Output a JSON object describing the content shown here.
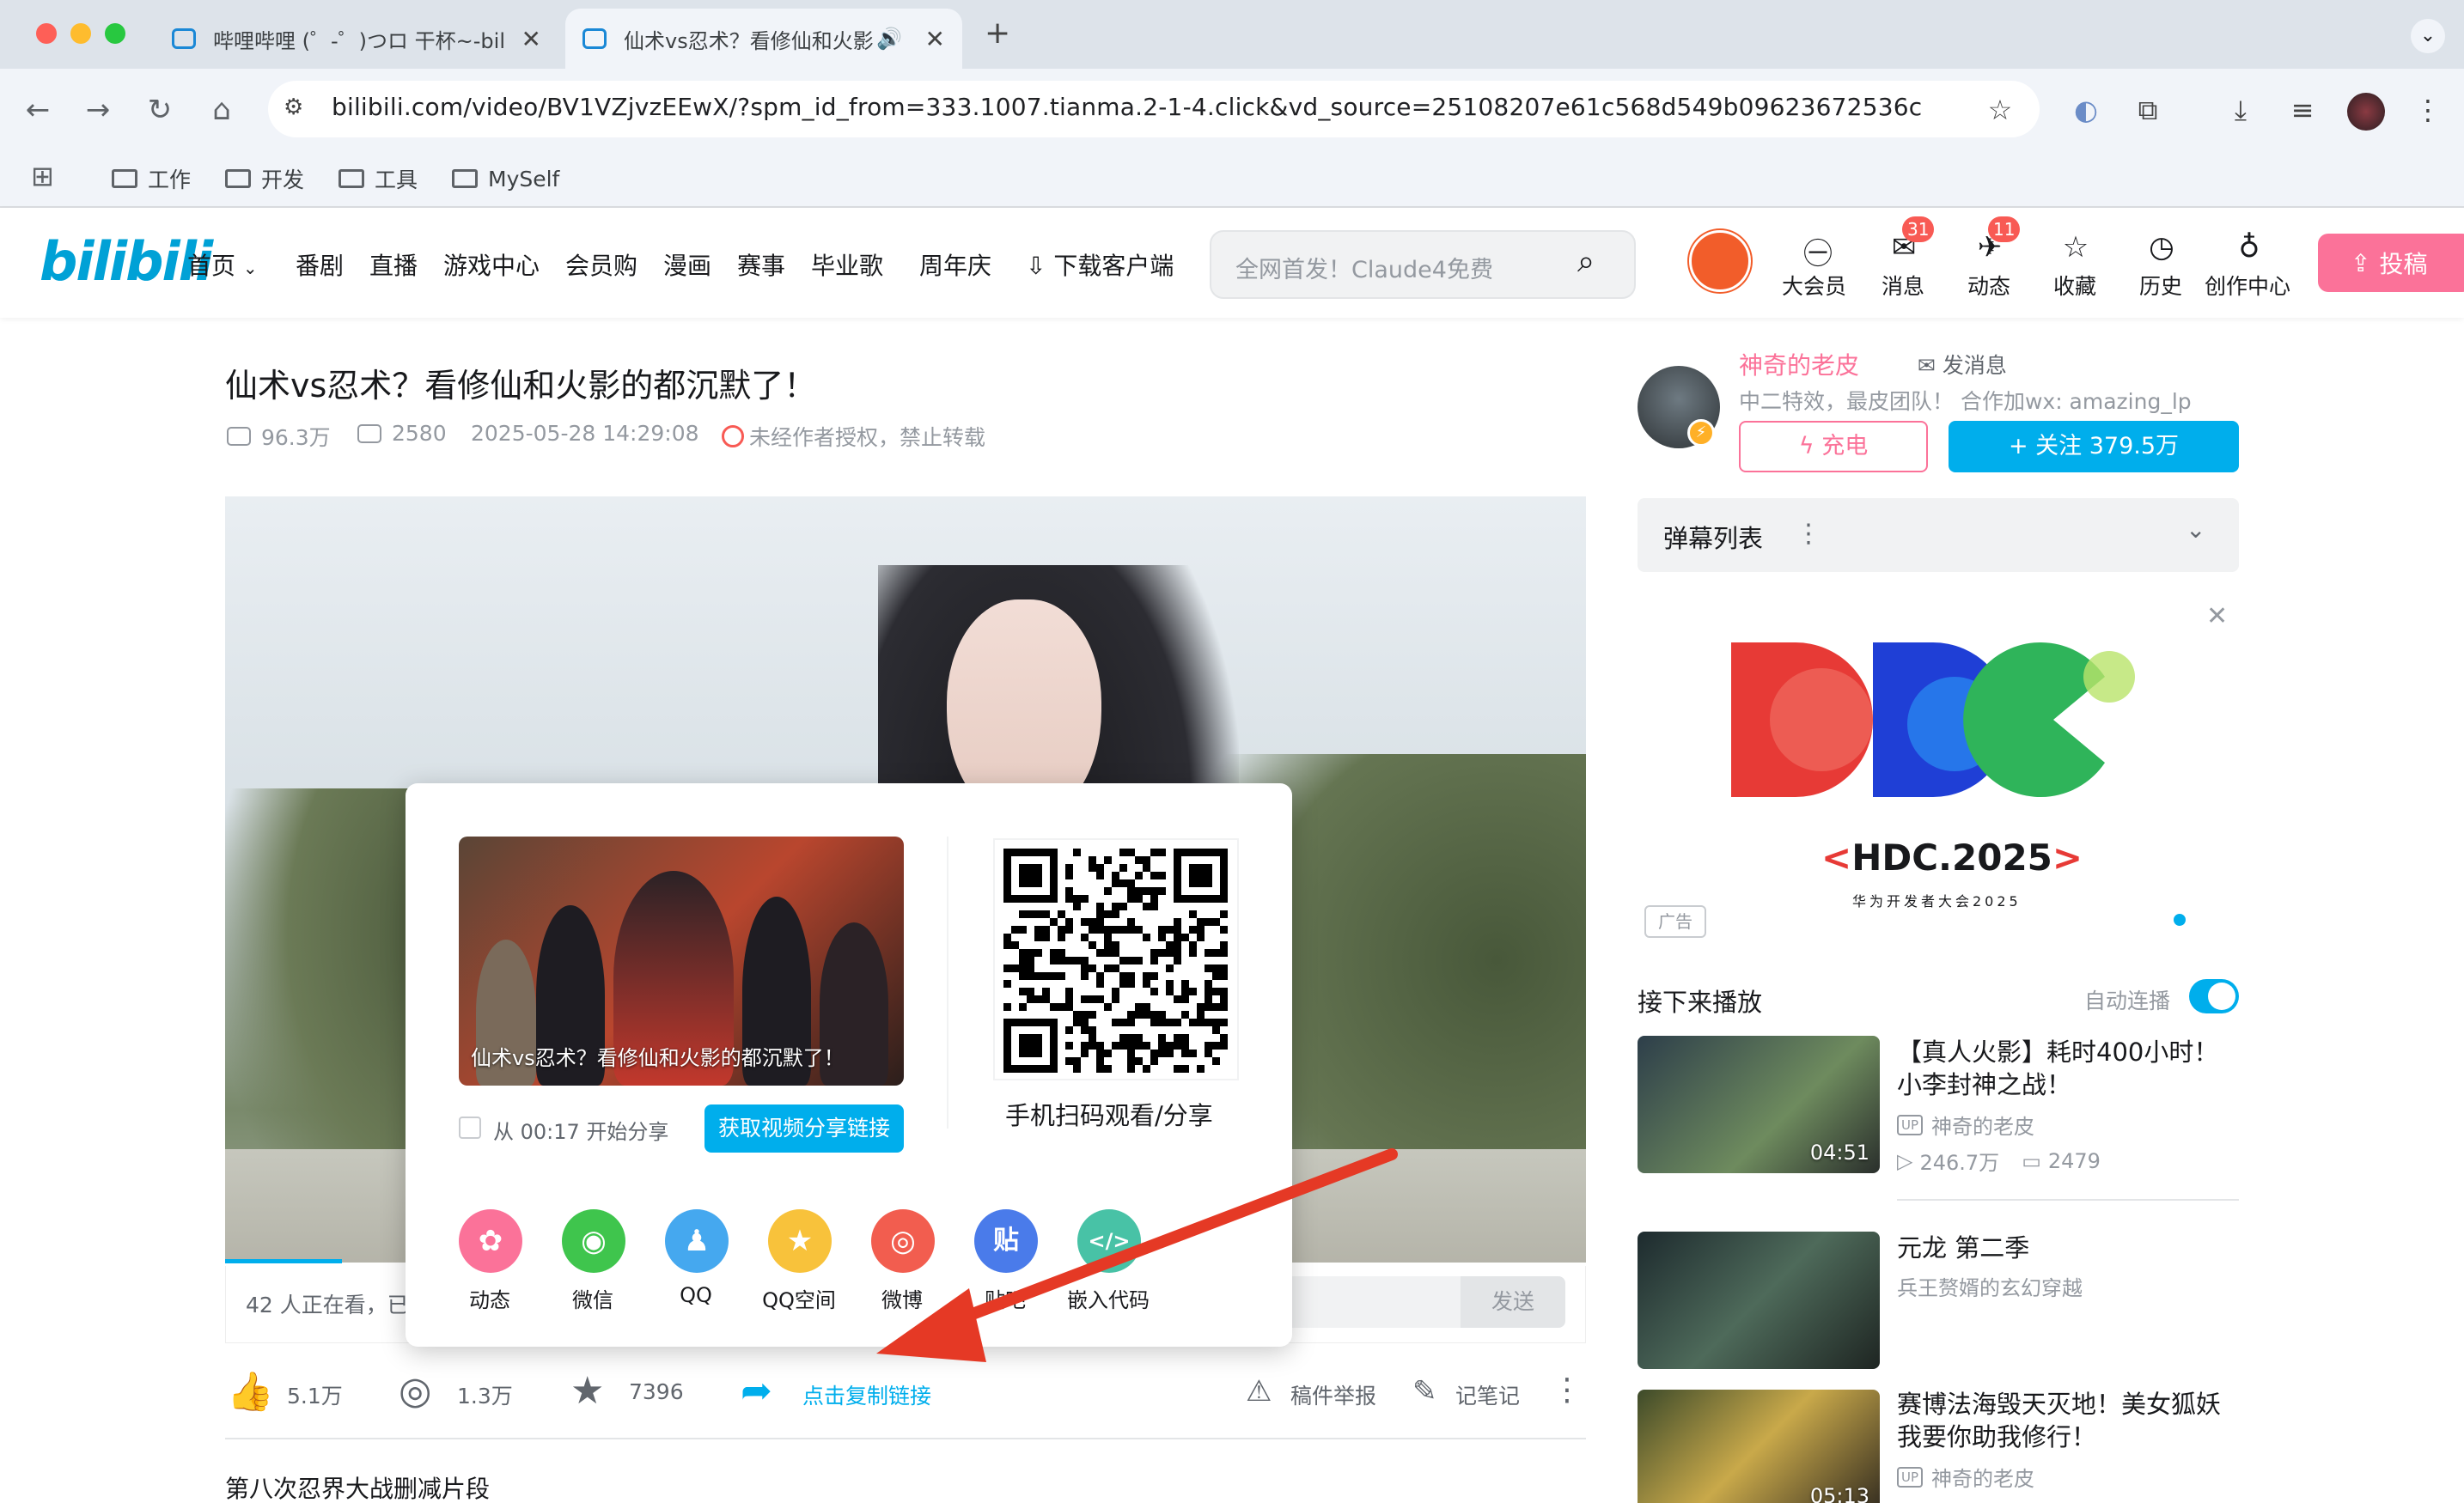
{
  "browser": {
    "tabs": [
      {
        "title": "哔哩哔哩 (゜-゜)つロ 干杯~-bili",
        "active": false
      },
      {
        "title": "仙术vs忍术？看修仙和火影",
        "active": true
      }
    ],
    "new_tab": "+",
    "url": "bilibili.com/video/BV1VZjvzEEwX/?spm_id_from=333.1007.tianma.2-1-4.click&vd_source=25108207e61c568d549b09623672536c",
    "bookmarks": [
      "工作",
      "开发",
      "工具",
      "MySelf"
    ]
  },
  "header": {
    "logo": "bilibili",
    "nav": [
      "首页",
      "番剧",
      "直播",
      "游戏中心",
      "会员购",
      "漫画",
      "赛事",
      "毕业歌",
      "周年庆",
      "下载客户端"
    ],
    "search_placeholder": "全网首发！Claude4免费",
    "icons": [
      {
        "label": "大会员",
        "icon": "vip-icon"
      },
      {
        "label": "消息",
        "icon": "message-icon",
        "badge": "31"
      },
      {
        "label": "动态",
        "icon": "dynamic-icon",
        "badge": "11"
      },
      {
        "label": "收藏",
        "icon": "favorite-icon"
      },
      {
        "label": "历史",
        "icon": "history-icon"
      },
      {
        "label": "创作中心",
        "icon": "creator-icon"
      }
    ],
    "upload": "投稿"
  },
  "video": {
    "title": "仙术vs忍术？看修仙和火影的都沉默了！",
    "views": "96.3万",
    "danmaku": "2580",
    "date": "2025-05-28 14:29:08",
    "no_repost": "未经作者授权，禁止转载",
    "progress": 0.086
  },
  "danmaku_bar": {
    "viewers": "42 人正在看，已",
    "send": "发送"
  },
  "share": {
    "thumb_caption": "仙术vs忍术？看修仙和火影的都沉默了！",
    "start_label": "从 00:17 开始分享",
    "get_link": "获取视频分享链接",
    "qr_label": "手机扫码观看/分享",
    "targets": [
      {
        "label": "动态",
        "color": "#fb7299",
        "glyph": "✿"
      },
      {
        "label": "微信",
        "color": "#3fc54d",
        "glyph": "◉"
      },
      {
        "label": "QQ",
        "color": "#45a8ef",
        "glyph": "♟"
      },
      {
        "label": "QQ空间",
        "color": "#f8c23b",
        "glyph": "★"
      },
      {
        "label": "微博",
        "color": "#f25d4f",
        "glyph": "◎"
      },
      {
        "label": "贴吧",
        "color": "#4a7bea",
        "glyph": "贴"
      },
      {
        "label": "嵌入代码",
        "color": "#48c2a6",
        "glyph": "</>"
      }
    ]
  },
  "actions": {
    "like": "5.1万",
    "coin": "1.3万",
    "fav": "7396",
    "copy_link": "点击复制链接",
    "report": "稿件举报",
    "note": "记笔记"
  },
  "section_title": "第八次忍界大战删减片段",
  "uploader": {
    "name": "神奇的老皮",
    "message": "发消息",
    "desc": "中二特效，最皮团队！ 合作加wx: amazing_lp",
    "charge": "充电",
    "follow": "+ 关注 379.5万"
  },
  "danmaku_list": {
    "label": "弹幕列表"
  },
  "ad": {
    "title_main": "HDC.2025",
    "subtitle": "华为开发者大会2025",
    "tag": "广告"
  },
  "upnext": {
    "label": "接下来播放",
    "autoplay": "自动连播",
    "items": [
      {
        "title": "【真人火影】耗时400小时！小李封神之战！",
        "duration": "04:51",
        "up": "神奇的老皮",
        "views": "246.7万",
        "danmaku": "2479"
      },
      {
        "title": "元龙 第二季",
        "sub": "兵王赘婿的玄幻穿越"
      },
      {
        "title": "赛博法海毁天灭地！美女狐妖我要你助我修行！",
        "duration": "05:13",
        "up": "神奇的老皮"
      }
    ]
  }
}
